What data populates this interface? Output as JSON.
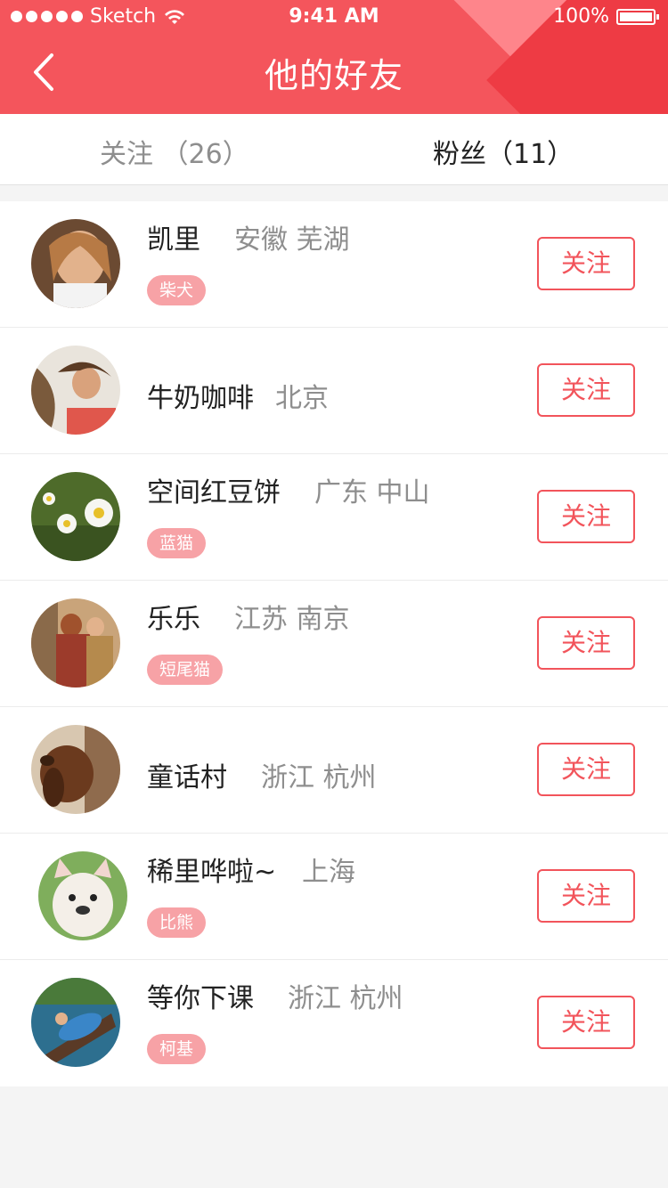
{
  "status_bar": {
    "carrier": "Sketch",
    "time": "9:41 AM",
    "battery": "100%"
  },
  "nav": {
    "title": "他的好友",
    "back_icon": "chevron-left-icon"
  },
  "tabs": [
    {
      "label": "关注 （26）",
      "active": false
    },
    {
      "label": "粉丝（11）",
      "active": true
    }
  ],
  "friends": [
    {
      "name": "凯里",
      "location": "安徽 芜湖",
      "tag": "柴犬",
      "button": "关注"
    },
    {
      "name": "牛奶咖啡",
      "location": "北京",
      "tag": "",
      "button": "关注"
    },
    {
      "name": "空间红豆饼",
      "location": "广东 中山",
      "tag": "蓝猫",
      "button": "关注"
    },
    {
      "name": "乐乐",
      "location": "江苏 南京",
      "tag": "短尾猫",
      "button": "关注"
    },
    {
      "name": "童话村",
      "location": "浙江 杭州",
      "tag": "",
      "button": "关注"
    },
    {
      "name": "稀里哗啦~",
      "location": "上海",
      "tag": "比熊",
      "button": "关注"
    },
    {
      "name": "等你下课",
      "location": "浙江 杭州",
      "tag": "柯基",
      "button": "关注"
    }
  ],
  "colors": {
    "brand": "#f4555c",
    "tag_bg": "#f7a2a6",
    "muted_text": "#8e8e8e"
  }
}
